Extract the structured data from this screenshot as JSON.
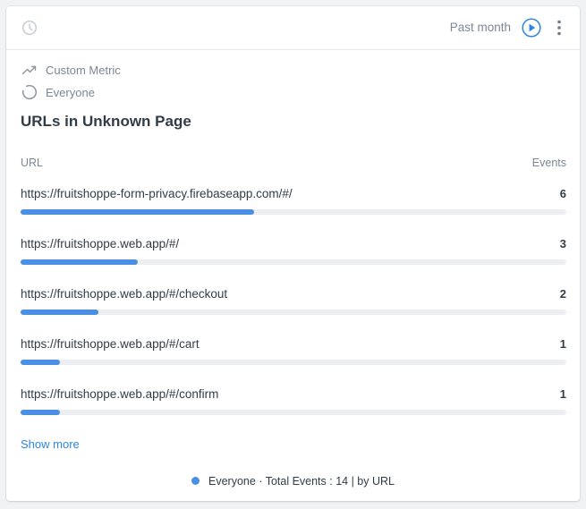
{
  "header": {
    "period_label": "Past month"
  },
  "meta": {
    "metric_label": "Custom Metric",
    "segment_label": "Everyone"
  },
  "title": "URLs in Unknown Page",
  "table": {
    "col_url": "URL",
    "col_events": "Events",
    "max_value": 14,
    "rows": [
      {
        "url": "https://fruitshoppe-form-privacy.firebaseapp.com/#/",
        "count": "6",
        "value": 6
      },
      {
        "url": "https://fruitshoppe.web.app/#/",
        "count": "3",
        "value": 3
      },
      {
        "url": "https://fruitshoppe.web.app/#/checkout",
        "count": "2",
        "value": 2
      },
      {
        "url": "https://fruitshoppe.web.app/#/cart",
        "count": "1",
        "value": 1
      },
      {
        "url": "https://fruitshoppe.web.app/#/confirm",
        "count": "1",
        "value": 1
      }
    ]
  },
  "show_more_label": "Show more",
  "legend": {
    "text": "Everyone · Total Events : 14 | by URL",
    "color": "#4a8fe2"
  },
  "colors": {
    "accent": "#4a8fe2",
    "link": "#2e86de",
    "muted": "#7b8794",
    "text": "#323c47"
  },
  "icons": {
    "clock": "clock-icon",
    "play": "play-circle-icon",
    "more": "kebab-menu-icon",
    "trend": "trend-line-icon",
    "segment": "segment-circle-icon"
  }
}
